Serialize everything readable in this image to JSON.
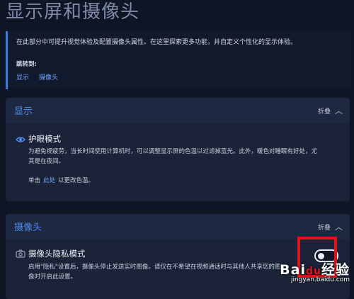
{
  "page": {
    "title": "显示屏和摄像头",
    "intro": "在此部分中可提升视觉体验及配置摄像头属性。在这里探索更多功能，并自定义个性化的显示体验。",
    "jump_label": "跳转到:",
    "jump_links": [
      "显示",
      "摄像头"
    ]
  },
  "display_section": {
    "title": "显示",
    "collapse_label": "折叠",
    "eye_care": {
      "title": "护眼模式",
      "desc": "为避免视疲劳，当长时间使用计算机时，可以调整显示屏的色温以过滤掉蓝光。此外，暖色对睡眠有好处，尤其是在夜间。",
      "click_prefix": "单击",
      "click_link": "此处",
      "click_suffix": "以更改色温。"
    }
  },
  "camera_section": {
    "title": "摄像头",
    "collapse_label": "折叠",
    "privacy": {
      "title": "摄像头隐私模式",
      "desc": "启用\"隐私\"设置后，摄像头停止发送实时图像。请仅在不希望在视频通话时与其他人共享您的图像时开启此设置。",
      "toggle_state": "on"
    }
  },
  "watermark": {
    "logo_a": "Bai",
    "logo_b": "经验",
    "url": "jingyan.baidu.com"
  },
  "colors": {
    "background": "#0f1524",
    "accent": "#4d8ff0",
    "link": "#6fa3ff",
    "highlight": "#e0141a"
  }
}
